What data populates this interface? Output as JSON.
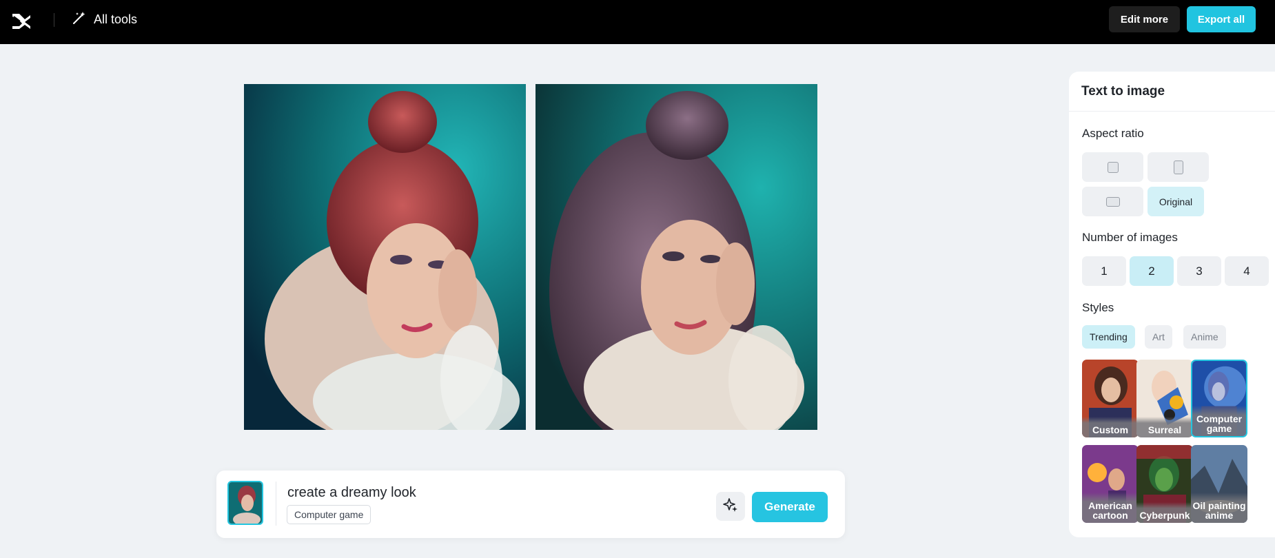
{
  "topbar": {
    "all_tools_label": "All tools",
    "edit_more_label": "Edit more",
    "export_all_label": "Export all"
  },
  "prompt": {
    "text": "create a dreamy look",
    "style_chip": "Computer game",
    "generate_label": "Generate"
  },
  "panel": {
    "title": "Text to image",
    "aspect_ratio_label": "Aspect ratio",
    "aspect_ratio_selected": "Original",
    "number_label": "Number of images",
    "numbers": [
      "1",
      "2",
      "3",
      "4"
    ],
    "number_selected": "2",
    "styles_label": "Styles",
    "style_tabs": [
      "Trending",
      "Art",
      "Anime"
    ],
    "style_tab_selected": "Trending",
    "style_cards": [
      "Custom",
      "Surreal",
      "Computer game",
      "American cartoon",
      "Cyberpunk",
      "Oil painting anime"
    ],
    "style_card_selected": "Computer game"
  },
  "colors": {
    "accent": "#22c5df",
    "topbar": "#000000",
    "background": "#eff2f5"
  },
  "icons": [
    "capcut-logo-icon",
    "magic-wand-icon",
    "sparkle-icon"
  ]
}
